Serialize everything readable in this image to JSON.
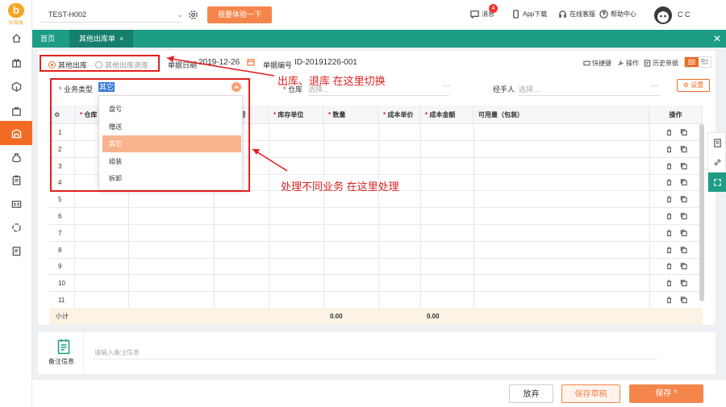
{
  "sidebar": {
    "logo_letter": "b",
    "logo_text": "标准版",
    "items": [
      "home-icon",
      "gift-icon",
      "box-icon",
      "bag-icon",
      "warehouse-icon",
      "money-bag-icon",
      "clipboard-icon",
      "id-card-icon",
      "cycle-icon",
      "doc-icon"
    ]
  },
  "topbar": {
    "store": "TEST-H002",
    "try_button": "我要体验一下",
    "messages": "消息",
    "message_count": "4",
    "app_download": "App下载",
    "online_service": "在线客服",
    "help": "帮助中心",
    "user": "C C"
  },
  "tabs": {
    "home": "首页",
    "current": "其他出库单",
    "close_x": "×"
  },
  "header": {
    "radio_out": "其他出库",
    "radio_return": "其他出库退库",
    "date_label": "单据日期",
    "date_value": "2019-12-26",
    "doc_no_label": "单据编号",
    "doc_no_value": "ID-20191226-001",
    "shortcut": "快捷键",
    "operation": "操作",
    "history": "历史单据"
  },
  "annotations": {
    "switch_note": "出库、退库 在这里切换",
    "business_note": "处理不同业务 在这里处理"
  },
  "form": {
    "business_type_label": "业务类型",
    "business_type_value": "其它",
    "warehouse_label": "仓库",
    "warehouse_placeholder": "选择...",
    "handler_label": "经手人",
    "handler_placeholder": "选择...",
    "settings": "设置"
  },
  "dropdown": {
    "options": [
      "盘亏",
      "赠送",
      "其它",
      "组装",
      "拆卸"
    ],
    "selected_index": 2
  },
  "table": {
    "columns": [
      "仓库",
      "",
      "",
      "库存单位",
      "数量",
      "成本单价",
      "成本金额",
      "可用量（包装）",
      "操作"
    ],
    "col_partial_label": "号",
    "rows": [
      "1",
      "2",
      "3",
      "4",
      "5",
      "6",
      "7",
      "8",
      "9",
      "10",
      "11"
    ],
    "subtotal_label": "小计",
    "subtotal_qty": "0.00",
    "subtotal_amount": "0.00"
  },
  "remark": {
    "label": "备注信息",
    "placeholder": "请输入备注信息"
  },
  "footer": {
    "cancel": "放弃",
    "save_draft": "保存草稿",
    "save": "保存 ^"
  },
  "colors": {
    "accent": "#f26b25",
    "teal": "#1d9c86",
    "annotation_red": "#e02020"
  }
}
